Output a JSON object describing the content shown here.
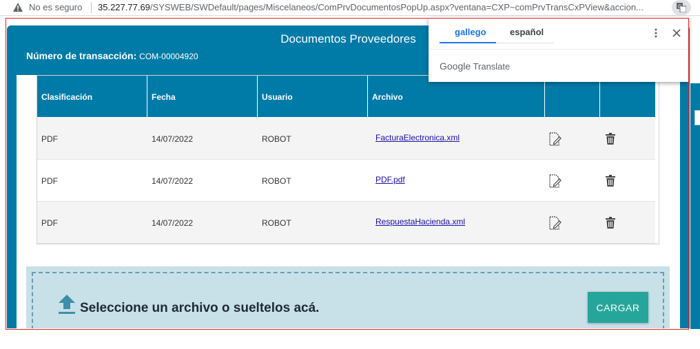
{
  "browser": {
    "security_text": "No es seguro",
    "url_host": "35.227.77.69",
    "url_path": "/SYSWEB/SWDefault/pages/Miscelaneos/ComPrvDocumentosPopUp.aspx?ventana=CXP~comPrvTransCxPView&accion..."
  },
  "modal": {
    "title": "Documentos Proveedores",
    "transaction_label": "Número de transacción:",
    "transaction_number": "COM-00004920"
  },
  "table": {
    "headers": [
      "Clasificación",
      "Fecha",
      "Usuario",
      "Archivo",
      "",
      ""
    ],
    "rows": [
      {
        "clasificacion": "PDF",
        "fecha": "14/07/2022",
        "usuario": "ROBOT",
        "archivo": "FacturaElectronica.xml"
      },
      {
        "clasificacion": "PDF",
        "fecha": "14/07/2022",
        "usuario": "ROBOT",
        "archivo": "PDF.pdf"
      },
      {
        "clasificacion": "PDF",
        "fecha": "14/07/2022",
        "usuario": "ROBOT",
        "archivo": "RespuestaHacienda.xml"
      }
    ],
    "row_icons": [
      "edit-document-icon",
      "trash-icon"
    ]
  },
  "upload": {
    "text": "Seleccione un archivo o sueltelos acá.",
    "button_label": "CARGAR"
  },
  "translate_popup": {
    "tabs": [
      "gallego",
      "español"
    ],
    "active_tab": "gallego",
    "brand_google": "Google",
    "brand_translate": "Translate"
  },
  "colors": {
    "header_blue": "#007ba8",
    "button_teal": "#26a69a",
    "dropzone_bg": "#c8e0e8",
    "outline_red": "#e02424",
    "tab_active": "#1a73e8"
  }
}
